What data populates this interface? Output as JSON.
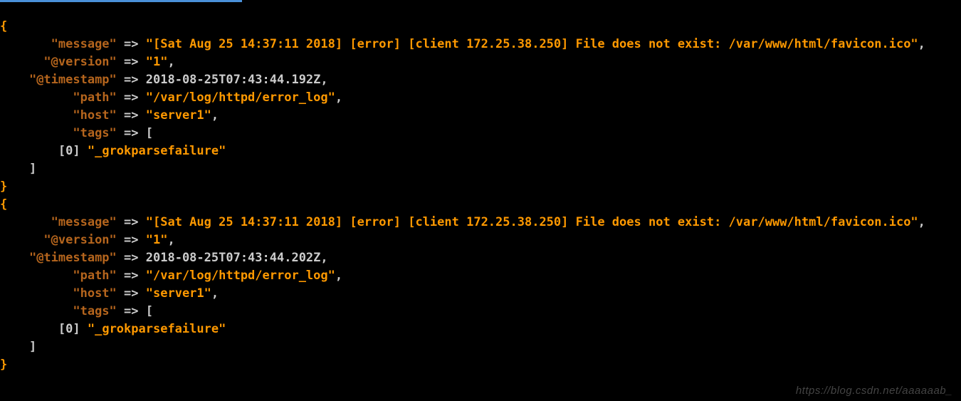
{
  "entries": [
    {
      "message": "\"[Sat Aug 25 14:37:11 2018] [error] [client 172.25.38.250] File does not exist: /var/www/html/favicon.ico\"",
      "version": "\"1\"",
      "timestamp": "2018-08-25T07:43:44.192Z",
      "path": "\"/var/log/httpd/error_log\"",
      "host": "\"server1\"",
      "tag_index": "[0]",
      "tag_value": "\"_grokparsefailure\""
    },
    {
      "message": "\"[Sat Aug 25 14:37:11 2018] [error] [client 172.25.38.250] File does not exist: /var/www/html/favicon.ico\"",
      "version": "\"1\"",
      "timestamp": "2018-08-25T07:43:44.202Z",
      "path": "\"/var/log/httpd/error_log\"",
      "host": "\"server1\"",
      "tag_index": "[0]",
      "tag_value": "\"_grokparsefailure\""
    }
  ],
  "keys": {
    "message": "\"message\"",
    "version": "\"@version\"",
    "timestamp": "\"@timestamp\"",
    "path": "\"path\"",
    "host": "\"host\"",
    "tags": "\"tags\""
  },
  "arrow": "=>",
  "open_brace": "{",
  "close_brace": "}",
  "open_bracket": "[",
  "close_bracket": "]",
  "comma": ",",
  "watermark": "https://blog.csdn.net/aaaaaab_"
}
